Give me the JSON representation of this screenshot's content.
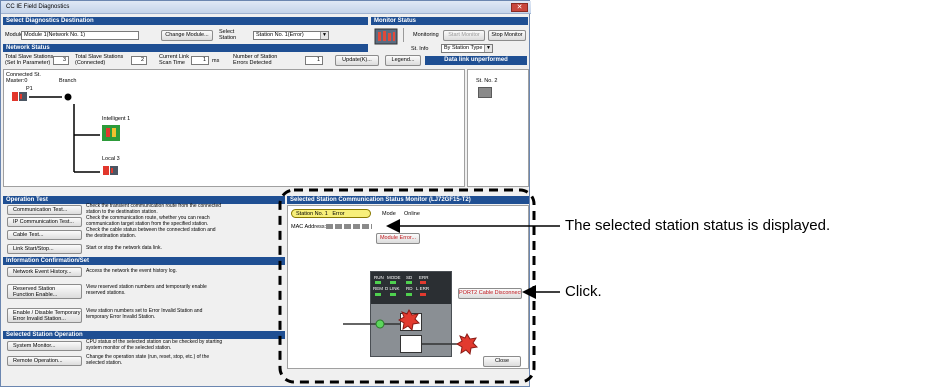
{
  "window": {
    "title": "CC IE Field Diagnostics",
    "close_glyph": "✕"
  },
  "select_dest": {
    "header": "Select Diagnostics Destination",
    "module_label": "Module",
    "module_value": "Module 1(Network No. 1)",
    "change_module_button": "Change Module...",
    "select_station_label": [
      "Select",
      "Station"
    ],
    "station_value": "Station No. 1(Error)"
  },
  "monitor_status": {
    "header": "Monitor Status",
    "status_text": "Monitoring",
    "start_button": "Start Monitor",
    "stop_button": "Stop Monitor",
    "st_info_label": "St. Info",
    "st_info_value": "By Station Type"
  },
  "network_status": {
    "header": "Network Status",
    "total_param_label": [
      "Total Slave Stations",
      "(Set In Parameter)"
    ],
    "total_param_value": "3",
    "total_conn_label": [
      "Total Slave Stations",
      "(Connected)"
    ],
    "total_conn_value": "2",
    "link_scan_label": [
      "Current Link",
      "Scan Time"
    ],
    "link_scan_value": "1",
    "link_scan_unit": "ms",
    "errors_label": [
      "Number of Station",
      "Errors Detected"
    ],
    "errors_value": "1",
    "update_button": "Update(K)...",
    "legend_button": "Legend...",
    "warning": "Data link unperformed"
  },
  "topology": {
    "connected_label": [
      "Connected St.",
      "Master:0"
    ],
    "branch_label": "Branch",
    "port_label": "P1",
    "intelligent_label": "Intelligent 1",
    "local_label": "Local 3",
    "st2_label": "St. No. 2"
  },
  "operation_test": {
    "header": "Operation Test",
    "rows": [
      {
        "button": "Communication Test...",
        "desc": [
          "Check the transient communication route from the connected",
          "station to the destination station."
        ]
      },
      {
        "button": "IP Communication Test...",
        "desc": [
          "Check the communication route, whether you can reach",
          "communication target station from the specified station."
        ]
      },
      {
        "button": "Cable Test...",
        "desc": [
          "Check the cable status between the connected station and",
          "the destination station."
        ]
      },
      {
        "button": "Link Start/Stop...",
        "desc": [
          "Start or stop the network data link."
        ]
      }
    ]
  },
  "info_confirm": {
    "header": "Information Confirmation/Set",
    "rows": [
      {
        "button": [
          "Network Event History..."
        ],
        "desc": [
          "Access the network the event history log."
        ]
      },
      {
        "button": [
          "Reserved Station",
          "Function Enable..."
        ],
        "desc": [
          "View reserved station numbers and temporarily enable",
          "reserved stations."
        ]
      },
      {
        "button": [
          "Enable / Disable Temporary",
          "Error Invalid Station..."
        ],
        "desc": [
          "View station numbers set to Error Invalid Station and",
          "temporary Error Invalid Station."
        ]
      }
    ]
  },
  "selected_op": {
    "header": "Selected Station Operation",
    "rows": [
      {
        "button": "System Monitor...",
        "desc": [
          "CPU status of the selected station can be checked by starting",
          "system monitor of the selected station."
        ]
      },
      {
        "button": "Remote Operation...",
        "desc": [
          "Change the operation state (run, reset, stop, etc.) of the",
          "selected station."
        ]
      }
    ]
  },
  "station_monitor": {
    "header": "Selected Station Communication Status Monitor (LJ72GF15-T2)",
    "station_badge": "Station No. 1   Error",
    "mode_label": "Mode",
    "mode_value": "Online",
    "mac_label": "MAC Address:",
    "module_error_button": "Module Error...",
    "led_row1": [
      "RUN",
      "MODE",
      "SD",
      "ERR"
    ],
    "led_row2": [
      "REM",
      "D LINK",
      "RD",
      "L ERR"
    ],
    "port_error": "PORT2 Cable Disconnected.",
    "close_button": "Close"
  },
  "callouts": {
    "status": "The selected station status is displayed.",
    "click": "Click."
  }
}
